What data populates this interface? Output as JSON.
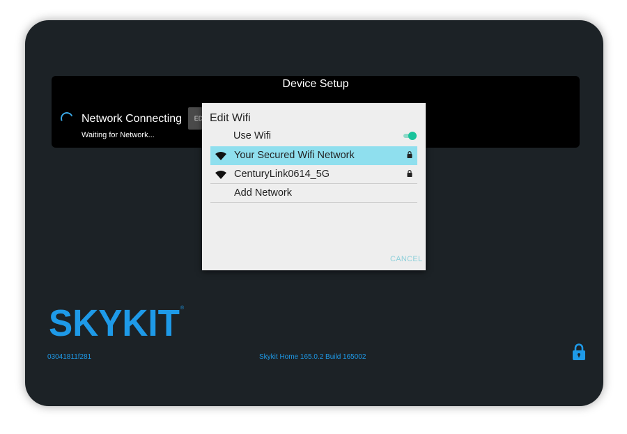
{
  "setup": {
    "title": "Device Setup",
    "status_title": "Network Connecting",
    "status_sub": "Waiting for Network...",
    "edit_label": "ED"
  },
  "dialog": {
    "title": "Edit Wifi",
    "use_wifi_label": "Use Wifi",
    "use_wifi_on": true,
    "networks": [
      {
        "ssid": "Your Secured Wifi Network",
        "icon": "wifi-icon",
        "secured": true,
        "selected": true
      },
      {
        "ssid": "CenturyLink0614_5G",
        "icon": "wifi-icon",
        "secured": true,
        "selected": false
      }
    ],
    "add_network_label": "Add Network",
    "cancel_label": "CANCEL"
  },
  "footer": {
    "logo_text": "SKYKIT",
    "serial": "03041811f281",
    "version": "Skykit Home 165.0.2 Build 165002",
    "lock_icon": "lock-icon"
  },
  "colors": {
    "accent": "#1e9ae8",
    "toggle_on": "#19c39b",
    "selected_row": "#8fdfee",
    "device_bg": "#1c2226"
  }
}
